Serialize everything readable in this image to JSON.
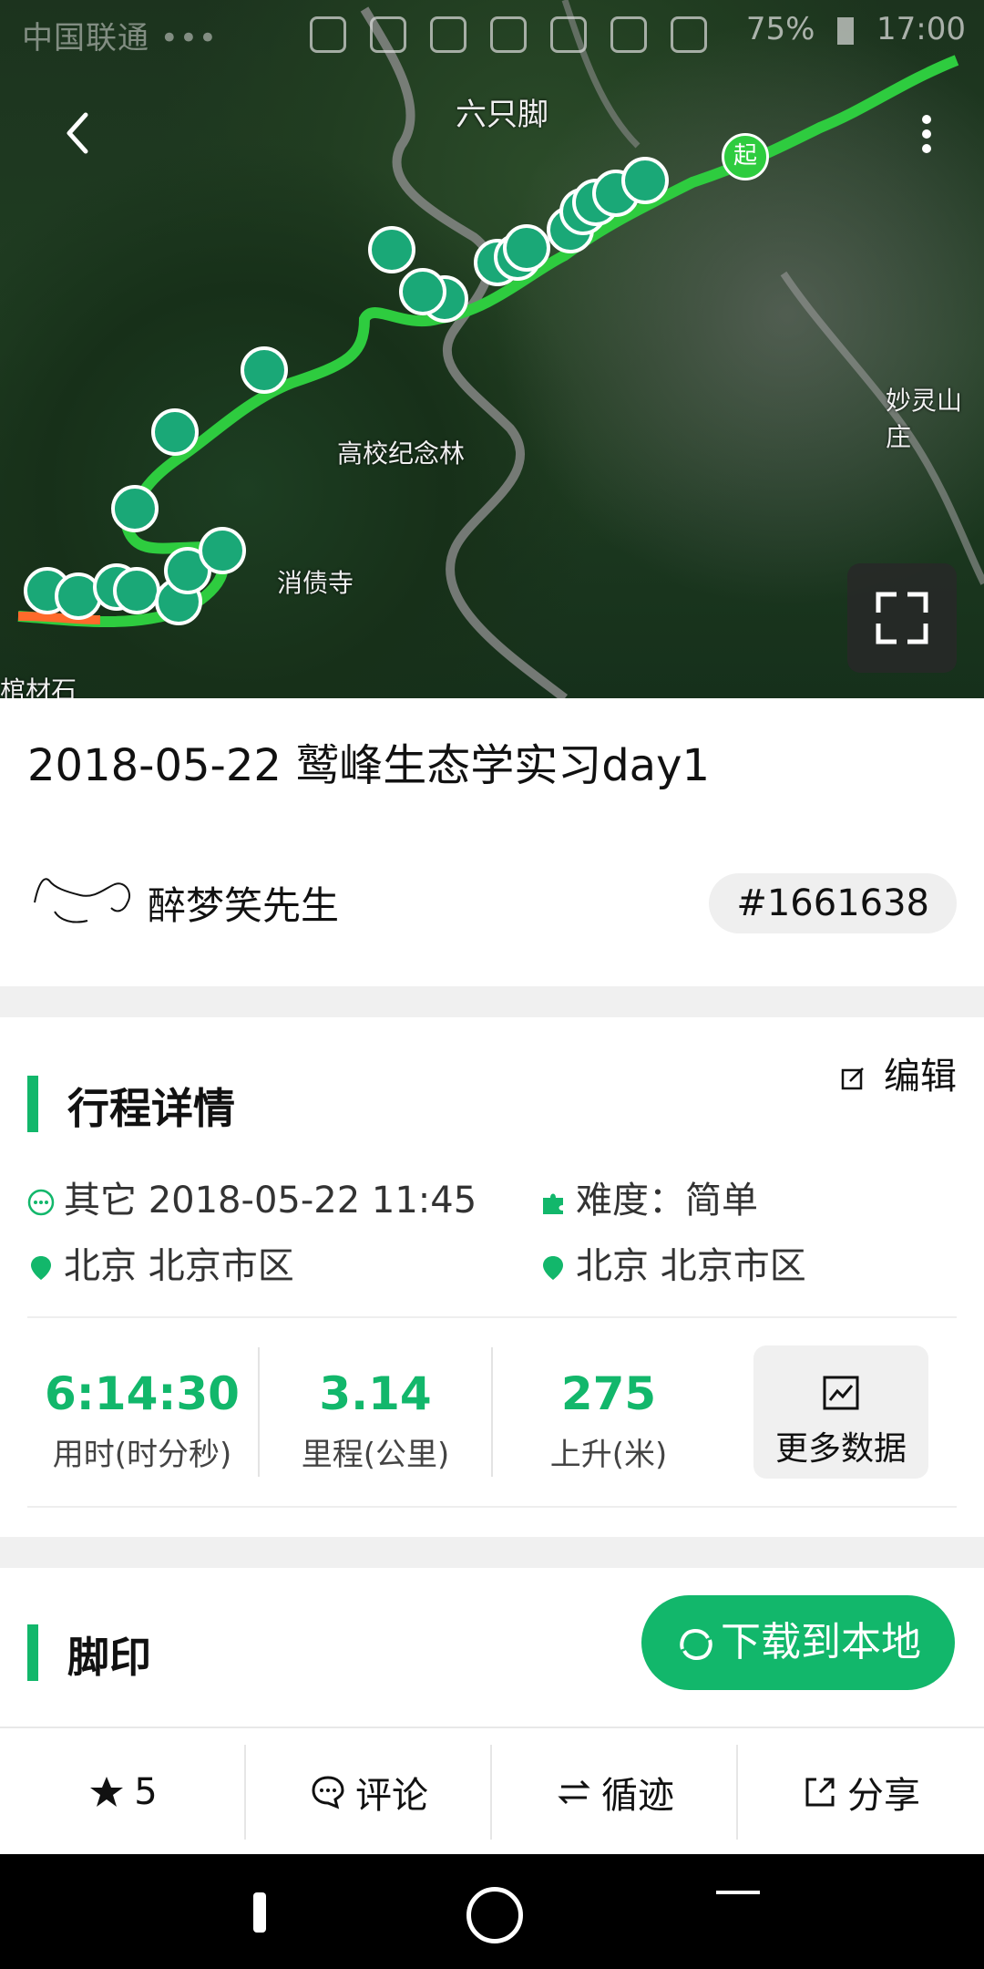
{
  "status": {
    "carrier": "中国联通 •••",
    "battery": "75%",
    "time": "17:00"
  },
  "map": {
    "labels": {
      "app_watermark": "六只脚",
      "poi_1": "妙灵山庄",
      "poi_2": "高校纪念林",
      "poi_3": "消债寺",
      "poi_4": "棺材石"
    },
    "start_marker": "起",
    "route_color": "#2ecc3f"
  },
  "track": {
    "title": "2018-05-22 鹫峰生态学实习day1",
    "author": "醉梦笑先生",
    "id": "#1661638"
  },
  "details": {
    "section_title": "行程详情",
    "edit": "编辑",
    "type_time": "其它 2018-05-22 11:45",
    "difficulty": "难度：简单",
    "start_place": "北京 北京市区",
    "end_place": "北京 北京市区"
  },
  "stats": [
    {
      "value": "6:14:30",
      "label": "用时(时分秒)"
    },
    {
      "value": "3.14",
      "label": "里程(公里)"
    },
    {
      "value": "275",
      "label": "上升(米)"
    }
  ],
  "more_data": "更多数据",
  "footprint": {
    "section_title": "脚印",
    "download": "下载到本地"
  },
  "bottom_tabs": [
    {
      "label": "5",
      "icon": "star-icon"
    },
    {
      "label": "评论",
      "icon": "comment-icon"
    },
    {
      "label": "循迹",
      "icon": "track-icon"
    },
    {
      "label": "分享",
      "icon": "share-icon"
    }
  ],
  "colors": {
    "accent": "#12b76b"
  }
}
